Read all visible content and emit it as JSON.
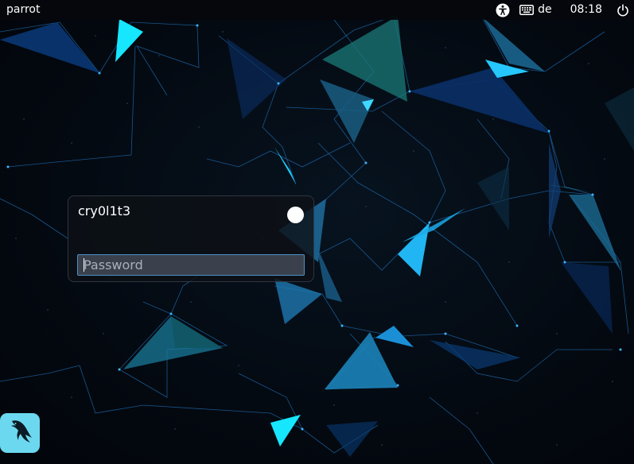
{
  "topbar": {
    "host": "parrot",
    "keyboard_layout": "de",
    "clock": "08:18"
  },
  "icons": {
    "accessibility": "accessibility-icon",
    "keyboard": "keyboard-icon",
    "power": "power-icon",
    "session": "session-indicator",
    "logo": "parrot-logo-icon"
  },
  "login": {
    "username": "cry0l1t3",
    "password_placeholder": "Password",
    "password_value": ""
  },
  "colors": {
    "accent": "#4a90c8",
    "logo_background": "#6cd8ef",
    "wallpaper_bright": "#16e7ff",
    "wallpaper_dark": "#0a2f66"
  }
}
